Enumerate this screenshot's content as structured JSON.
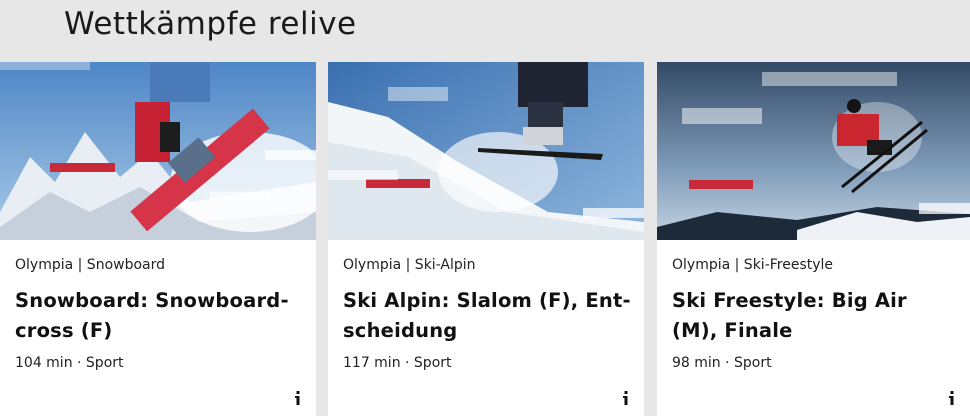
{
  "section": {
    "title": "Wettkämpfe relive"
  },
  "colors": {
    "accent": "#c92a3a",
    "page_bg": "#e7e7e7",
    "card_bg": "#ffffff"
  },
  "cards": [
    {
      "kicker": "Olympia | Snowboard",
      "title": "Snowboard: Snowboard-cross (F)",
      "meta": "104 min · Sport",
      "info_icon": "info-icon"
    },
    {
      "kicker": "Olympia | Ski-Alpin",
      "title": "Ski Alpin: Slalom (F), Ent-scheidung",
      "meta": "117 min · Sport",
      "info_icon": "info-icon"
    },
    {
      "kicker": "Olympia | Ski-Freestyle",
      "title": "Ski Freestyle: Big Air (M), Finale",
      "meta": "98 min · Sport",
      "info_icon": "info-icon"
    }
  ]
}
